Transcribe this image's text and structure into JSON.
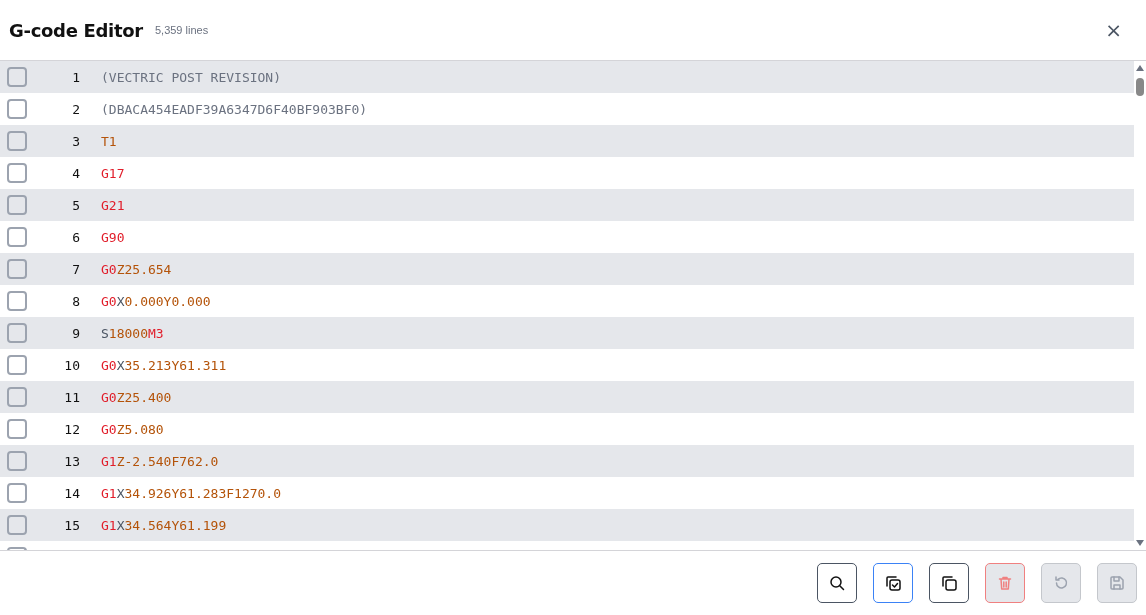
{
  "header": {
    "title": "G-code Editor",
    "line_count": "5,359 lines",
    "close": "×"
  },
  "lines": [
    {
      "number": "1",
      "checked": false,
      "tokens": [
        {
          "text": "(VECTRIC POST REVISION)",
          "kind": "comment"
        }
      ]
    },
    {
      "number": "2",
      "checked": false,
      "tokens": [
        {
          "text": "(DBACA454EADF39A6347D6F40BF903BF0)",
          "kind": "comment"
        }
      ]
    },
    {
      "number": "3",
      "checked": false,
      "tokens": [
        {
          "text": "T1",
          "kind": "value"
        }
      ]
    },
    {
      "number": "4",
      "checked": false,
      "tokens": [
        {
          "text": "G17",
          "kind": "command"
        }
      ]
    },
    {
      "number": "5",
      "checked": false,
      "tokens": [
        {
          "text": "G21",
          "kind": "command"
        }
      ]
    },
    {
      "number": "6",
      "checked": false,
      "tokens": [
        {
          "text": "G90",
          "kind": "command"
        }
      ]
    },
    {
      "number": "7",
      "checked": false,
      "tokens": [
        {
          "text": "G0",
          "kind": "command"
        },
        {
          "text": "Z25.654",
          "kind": "value"
        }
      ]
    },
    {
      "number": "8",
      "checked": false,
      "tokens": [
        {
          "text": "G0",
          "kind": "command"
        },
        {
          "text": "X",
          "kind": "axis"
        },
        {
          "text": "0.000Y0.000",
          "kind": "value"
        }
      ]
    },
    {
      "number": "9",
      "checked": false,
      "tokens": [
        {
          "text": "S",
          "kind": "axis"
        },
        {
          "text": "18000",
          "kind": "value"
        },
        {
          "text": "M3",
          "kind": "command"
        }
      ]
    },
    {
      "number": "10",
      "checked": false,
      "tokens": [
        {
          "text": "G0",
          "kind": "command"
        },
        {
          "text": "X",
          "kind": "axis"
        },
        {
          "text": "35.213Y61.311",
          "kind": "value"
        }
      ]
    },
    {
      "number": "11",
      "checked": false,
      "tokens": [
        {
          "text": "G0",
          "kind": "command"
        },
        {
          "text": "Z25.400",
          "kind": "value"
        }
      ]
    },
    {
      "number": "12",
      "checked": false,
      "tokens": [
        {
          "text": "G0",
          "kind": "command"
        },
        {
          "text": "Z5.080",
          "kind": "value"
        }
      ]
    },
    {
      "number": "13",
      "checked": false,
      "tokens": [
        {
          "text": "G1",
          "kind": "command"
        },
        {
          "text": "Z-2.540F762.0",
          "kind": "value"
        }
      ]
    },
    {
      "number": "14",
      "checked": false,
      "tokens": [
        {
          "text": "G1",
          "kind": "command"
        },
        {
          "text": "X",
          "kind": "axis"
        },
        {
          "text": "34.926Y61.283F1270.0",
          "kind": "value"
        }
      ]
    },
    {
      "number": "15",
      "checked": false,
      "tokens": [
        {
          "text": "G1",
          "kind": "command"
        },
        {
          "text": "X",
          "kind": "axis"
        },
        {
          "text": "34.564Y61.199",
          "kind": "value"
        }
      ]
    }
  ],
  "toolbar": [
    {
      "kind": "search",
      "disabled": false
    },
    {
      "kind": "select-all",
      "disabled": false
    },
    {
      "kind": "copy",
      "disabled": false
    },
    {
      "kind": "delete",
      "disabled": true
    },
    {
      "kind": "undo",
      "disabled": true
    },
    {
      "kind": "save",
      "disabled": true
    }
  ]
}
